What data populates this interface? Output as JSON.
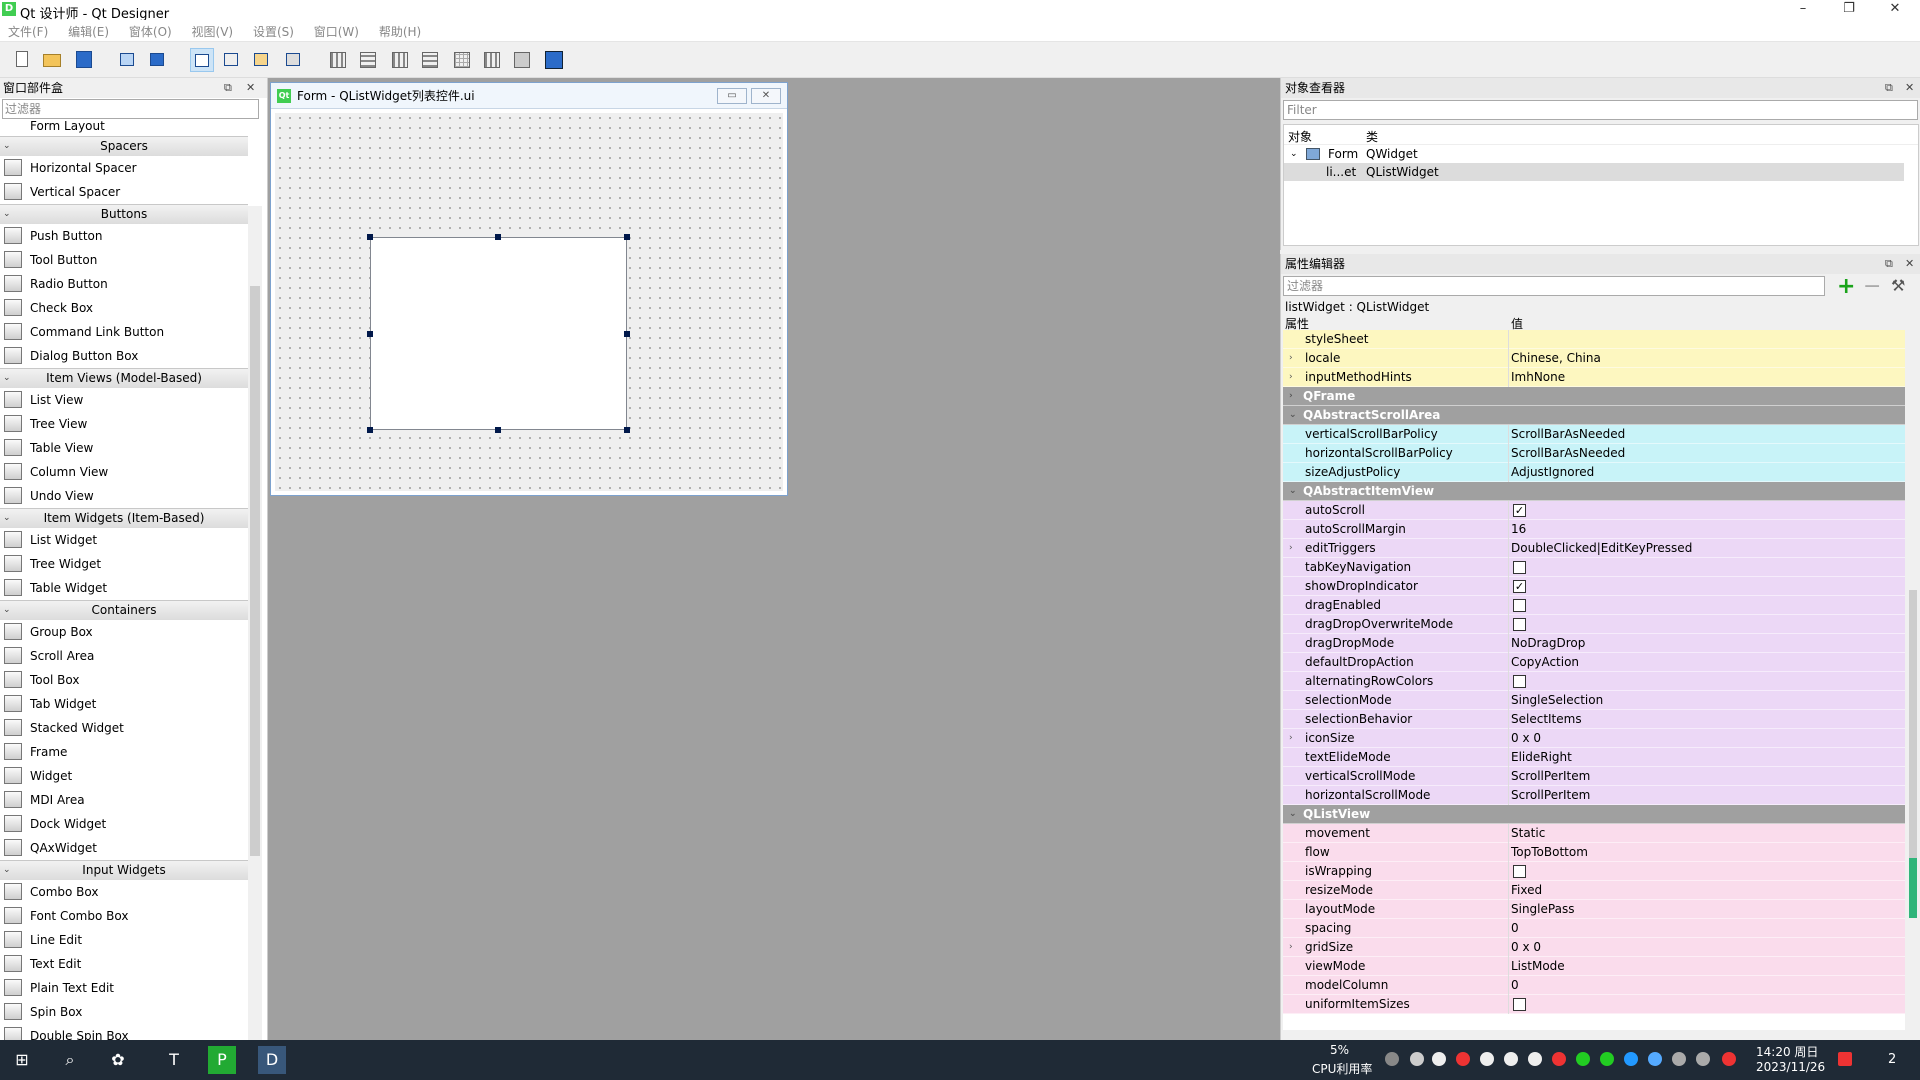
{
  "window": {
    "title": "Qt 设计师 - Qt Designer",
    "app_icon": "D",
    "min": "–",
    "max": "❐",
    "close": "✕"
  },
  "menu": [
    "文件(F)",
    "编辑(E)",
    "窗体(O)",
    "视图(V)",
    "设置(S)",
    "窗口(W)",
    "帮助(H)"
  ],
  "widget_box": {
    "title": "窗口部件盒",
    "filter_placeholder": "过滤器",
    "partial_item": "Form Layout",
    "sections": [
      {
        "name": "Spacers",
        "items": [
          "Horizontal Spacer",
          "Vertical Spacer"
        ]
      },
      {
        "name": "Buttons",
        "items": [
          "Push Button",
          "Tool Button",
          "Radio Button",
          "Check Box",
          "Command Link Button",
          "Dialog Button Box"
        ]
      },
      {
        "name": "Item Views (Model-Based)",
        "items": [
          "List View",
          "Tree View",
          "Table View",
          "Column View",
          "Undo View"
        ]
      },
      {
        "name": "Item Widgets (Item-Based)",
        "items": [
          "List Widget",
          "Tree Widget",
          "Table Widget"
        ]
      },
      {
        "name": "Containers",
        "items": [
          "Group Box",
          "Scroll Area",
          "Tool Box",
          "Tab Widget",
          "Stacked Widget",
          "Frame",
          "Widget",
          "MDI Area",
          "Dock Widget",
          "QAxWidget"
        ]
      },
      {
        "name": "Input Widgets",
        "items": [
          "Combo Box",
          "Font Combo Box",
          "Line Edit",
          "Text Edit",
          "Plain Text Edit",
          "Spin Box",
          "Double Spin Box"
        ]
      }
    ]
  },
  "form": {
    "title": "Form - QListWidget列表控件.ui",
    "app_icon": "Qt"
  },
  "object_inspector": {
    "title": "对象查看器",
    "filter_placeholder": "Filter",
    "col_object": "对象",
    "col_class": "类",
    "rows": [
      {
        "object": "Form",
        "class": "QWidget"
      },
      {
        "object": "li...et",
        "class": "QListWidget"
      }
    ]
  },
  "property_editor": {
    "title": "属性编辑器",
    "filter_placeholder": "过滤器",
    "object_label": "listWidget : QListWidget",
    "col_prop": "属性",
    "col_value": "值",
    "rows": [
      {
        "name": "styleSheet",
        "value": "",
        "color": "#fdf7c0"
      },
      {
        "name": "locale",
        "value": "Chinese, China",
        "color": "#fdf7c0",
        "expand": "›"
      },
      {
        "name": "inputMethodHints",
        "value": "ImhNone",
        "color": "#fdf7c0",
        "expand": "›"
      },
      {
        "name": "QFrame",
        "group": true,
        "expand": "›"
      },
      {
        "name": "QAbstractScrollArea",
        "group": true,
        "expand": "⌄"
      },
      {
        "name": "verticalScrollBarPolicy",
        "value": "ScrollBarAsNeeded",
        "color": "#c8f3f8"
      },
      {
        "name": "horizontalScrollBarPolicy",
        "value": "ScrollBarAsNeeded",
        "color": "#c8f3f8"
      },
      {
        "name": "sizeAdjustPolicy",
        "value": "AdjustIgnored",
        "color": "#c8f3f8"
      },
      {
        "name": "QAbstractItemView",
        "group": true,
        "expand": "⌄"
      },
      {
        "name": "autoScroll",
        "check": true,
        "color": "#ecd8f6"
      },
      {
        "name": "autoScrollMargin",
        "value": "16",
        "color": "#ecd8f6"
      },
      {
        "name": "editTriggers",
        "value": "DoubleClicked|EditKeyPressed",
        "color": "#ecd8f6",
        "expand": "›"
      },
      {
        "name": "tabKeyNavigation",
        "check": false,
        "color": "#ecd8f6"
      },
      {
        "name": "showDropIndicator",
        "check": true,
        "color": "#ecd8f6"
      },
      {
        "name": "dragEnabled",
        "check": false,
        "color": "#ecd8f6"
      },
      {
        "name": "dragDropOverwriteMode",
        "check": false,
        "color": "#ecd8f6"
      },
      {
        "name": "dragDropMode",
        "value": "NoDragDrop",
        "color": "#ecd8f6"
      },
      {
        "name": "defaultDropAction",
        "value": "CopyAction",
        "color": "#ecd8f6"
      },
      {
        "name": "alternatingRowColors",
        "check": false,
        "color": "#ecd8f6"
      },
      {
        "name": "selectionMode",
        "value": "SingleSelection",
        "color": "#ecd8f6"
      },
      {
        "name": "selectionBehavior",
        "value": "SelectItems",
        "color": "#ecd8f6"
      },
      {
        "name": "iconSize",
        "value": "0 x 0",
        "color": "#ecd8f6",
        "expand": "›"
      },
      {
        "name": "textElideMode",
        "value": "ElideRight",
        "color": "#ecd8f6"
      },
      {
        "name": "verticalScrollMode",
        "value": "ScrollPerItem",
        "color": "#ecd8f6"
      },
      {
        "name": "horizontalScrollMode",
        "value": "ScrollPerItem",
        "color": "#ecd8f6"
      },
      {
        "name": "QListView",
        "group": true,
        "expand": "⌄"
      },
      {
        "name": "movement",
        "value": "Static",
        "color": "#fadcec"
      },
      {
        "name": "flow",
        "value": "TopToBottom",
        "color": "#fadcec"
      },
      {
        "name": "isWrapping",
        "check": false,
        "color": "#fadcec"
      },
      {
        "name": "resizeMode",
        "value": "Fixed",
        "color": "#fadcec"
      },
      {
        "name": "layoutMode",
        "value": "SinglePass",
        "color": "#fadcec"
      },
      {
        "name": "spacing",
        "value": "0",
        "color": "#fadcec"
      },
      {
        "name": "gridSize",
        "value": "0 x 0",
        "color": "#fadcec",
        "expand": "›"
      },
      {
        "name": "viewMode",
        "value": "ListMode",
        "color": "#fadcec"
      },
      {
        "name": "modelColumn",
        "value": "0",
        "color": "#fadcec"
      },
      {
        "name": "uniformItemSizes",
        "check": false,
        "color": "#fadcec"
      }
    ]
  },
  "taskbar": {
    "cpu_percent": "5%",
    "cpu_label": "CPU利用率",
    "time": "14:20 周日",
    "date": "2023/11/26",
    "notifications": "2"
  }
}
